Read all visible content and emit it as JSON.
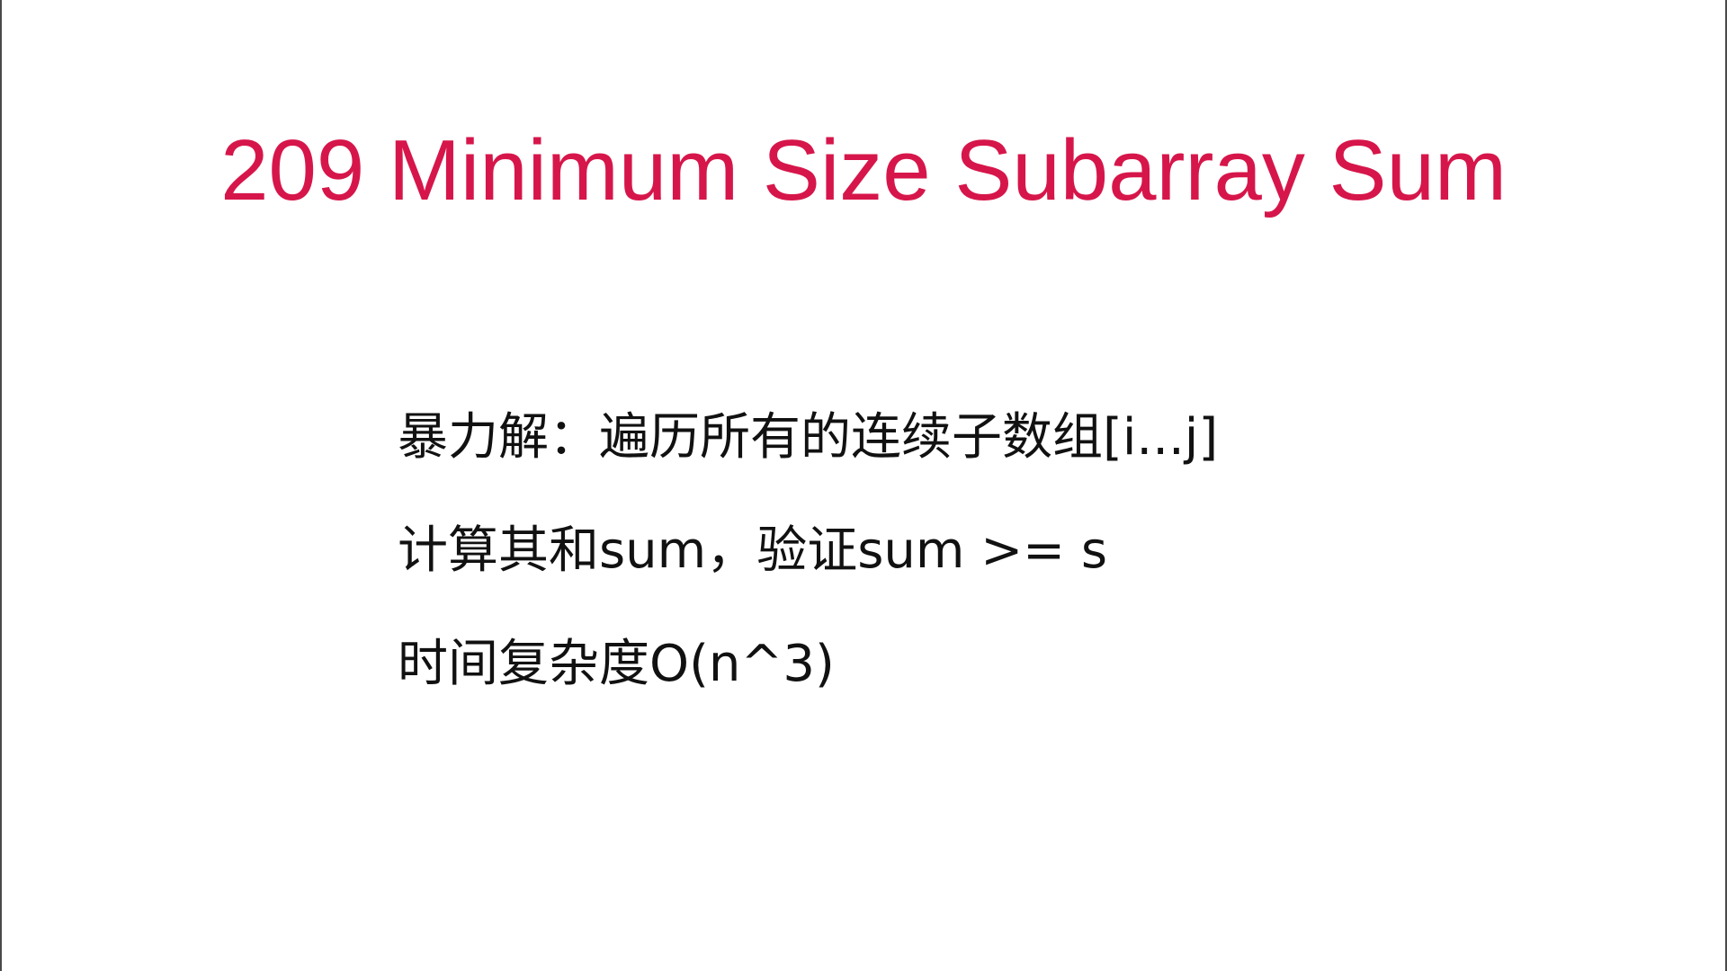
{
  "slide": {
    "title": "209 Minimum Size Subarray Sum",
    "lines": [
      "暴力解：遍历所有的连续子数组[i...j]",
      "计算其和sum，验证sum >= s",
      "时间复杂度O(n^3)"
    ]
  },
  "colors": {
    "title": "#d6164a",
    "body_text": "#111111",
    "background": "#ffffff"
  }
}
